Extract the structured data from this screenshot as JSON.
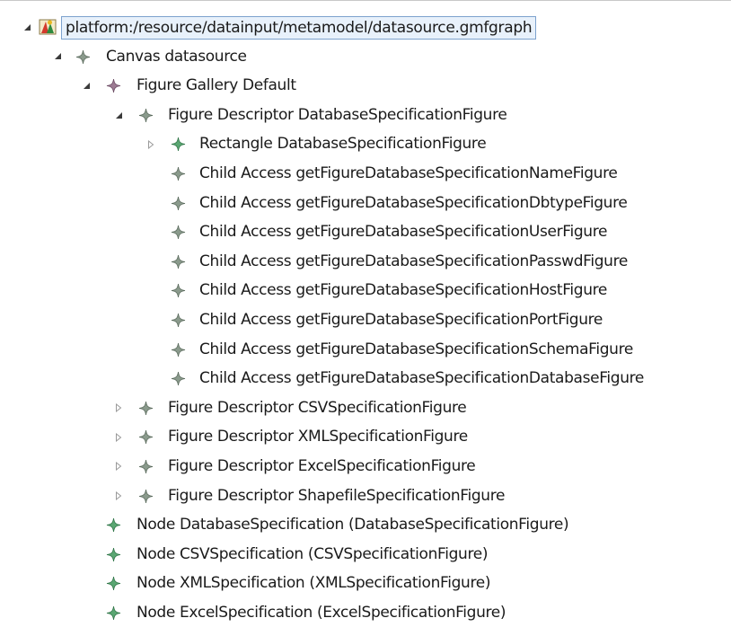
{
  "tree": {
    "root": {
      "label": "platform:/resource/datainput/metamodel/datasource.gmfgraph",
      "icon": "gmfgraph-resource-icon",
      "expanded": true
    },
    "canvas": {
      "label": "Canvas datasource",
      "icon": "diamond-gray-icon",
      "expanded": true
    },
    "gallery": {
      "label": "Figure Gallery Default",
      "icon": "diamond-purple-icon",
      "expanded": true
    },
    "descriptor_db": {
      "label": "Figure Descriptor DatabaseSpecificationFigure",
      "icon": "diamond-gray-icon",
      "expanded": true
    },
    "rectangle": {
      "label": "Rectangle DatabaseSpecificationFigure",
      "icon": "diamond-green-icon",
      "expanded": false
    },
    "child_access": [
      {
        "label": "Child Access getFigureDatabaseSpecificationNameFigure"
      },
      {
        "label": "Child Access getFigureDatabaseSpecificationDbtypeFigure"
      },
      {
        "label": "Child Access getFigureDatabaseSpecificationUserFigure"
      },
      {
        "label": "Child Access getFigureDatabaseSpecificationPasswdFigure"
      },
      {
        "label": "Child Access getFigureDatabaseSpecificationHostFigure"
      },
      {
        "label": "Child Access getFigureDatabaseSpecificationPortFigure"
      },
      {
        "label": "Child Access getFigureDatabaseSpecificationSchemaFigure"
      },
      {
        "label": "Child Access getFigureDatabaseSpecificationDatabaseFigure"
      }
    ],
    "descriptors": [
      {
        "label": "Figure Descriptor CSVSpecificationFigure",
        "expanded": false
      },
      {
        "label": "Figure Descriptor XMLSpecificationFigure",
        "expanded": false
      },
      {
        "label": "Figure Descriptor ExcelSpecificationFigure",
        "expanded": false
      },
      {
        "label": "Figure Descriptor ShapefileSpecificationFigure",
        "expanded": false
      }
    ],
    "nodes": [
      {
        "label": "Node DatabaseSpecification (DatabaseSpecificationFigure)"
      },
      {
        "label": "Node CSVSpecification (CSVSpecificationFigure)"
      },
      {
        "label": "Node XMLSpecification (XMLSpecificationFigure)"
      },
      {
        "label": "Node ExcelSpecification (ExcelSpecificationFigure)"
      }
    ]
  },
  "colors": {
    "diamond_gray": "#8a9a8c",
    "diamond_purple": "#9c7a92",
    "diamond_green": "#5aa672",
    "selection_border": "#7da2ce",
    "selection_fill": "#e8f1fb"
  }
}
